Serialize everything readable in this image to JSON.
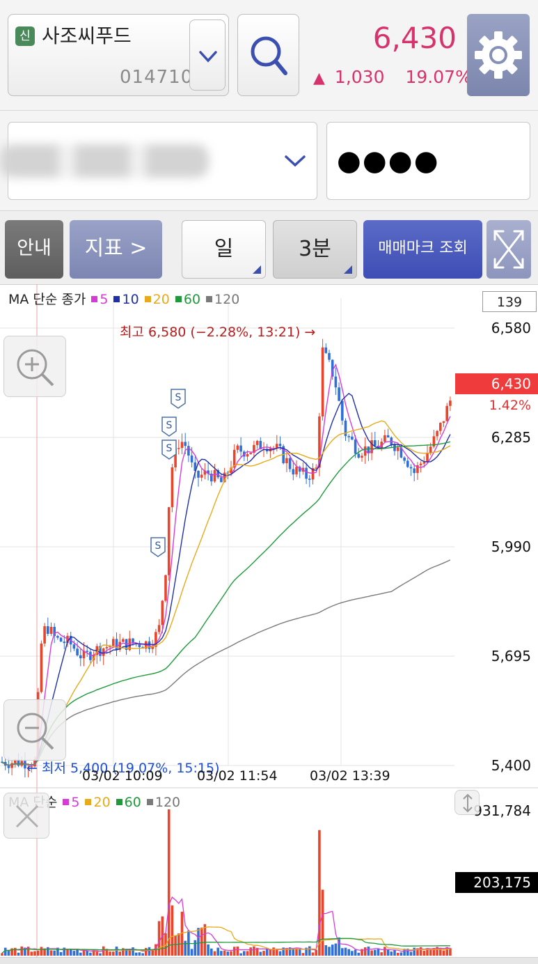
{
  "header": {
    "badge": "신",
    "stock_name": "사조씨푸드",
    "stock_code": "014710",
    "price": "6,430",
    "change_arrow": "▲",
    "change_amount": "1,030",
    "change_rate": "19.07%"
  },
  "account": {
    "password_mask": "●●●●"
  },
  "toolbar": {
    "info": "안내",
    "indicator": "지표 >",
    "period": "일",
    "interval": "3분",
    "trade_mark": "매매마크 조회"
  },
  "chart": {
    "legend_label": "MA 단순 종가",
    "legend_items": [
      {
        "label": "5",
        "color": "#d63bd6"
      },
      {
        "label": "10",
        "color": "#1f2fa8"
      },
      {
        "label": "20",
        "color": "#e8a91a"
      },
      {
        "label": "60",
        "color": "#1d9a3a"
      },
      {
        "label": "120",
        "color": "#7a7a7a"
      }
    ],
    "count": "139",
    "current_price": "6,430",
    "current_pct": "1.42%",
    "high_annotation": "최고 6,580 (−2.28%, 13:21) →",
    "low_annotation": "← 최저 5,400 (19.07%, 15:15)",
    "sell_mark": "S"
  },
  "volume": {
    "legend_label": "MA 단순",
    "legend_items": [
      {
        "label": "5",
        "color": "#d63bd6"
      },
      {
        "label": "20",
        "color": "#e8a91a"
      },
      {
        "label": "60",
        "color": "#1d9a3a"
      },
      {
        "label": "120",
        "color": "#7a7a7a"
      }
    ],
    "max_label": "931,784",
    "current_label": "203,175"
  },
  "chart_data": {
    "type": "candlestick",
    "y_ticks": [
      "6,580",
      "6,285",
      "5,990",
      "5,695",
      "5,400"
    ],
    "y_values": [
      6580,
      6285,
      5990,
      5695,
      5400
    ],
    "ylim": [
      5400,
      6580
    ],
    "x_ticks": [
      "03/02 10:09",
      "03/02 11:54",
      "03/02 13:39"
    ],
    "high": 6580,
    "low": 5400,
    "last": 6430,
    "volume_ylim": [
      0,
      931784
    ],
    "last_volume": 203175
  }
}
